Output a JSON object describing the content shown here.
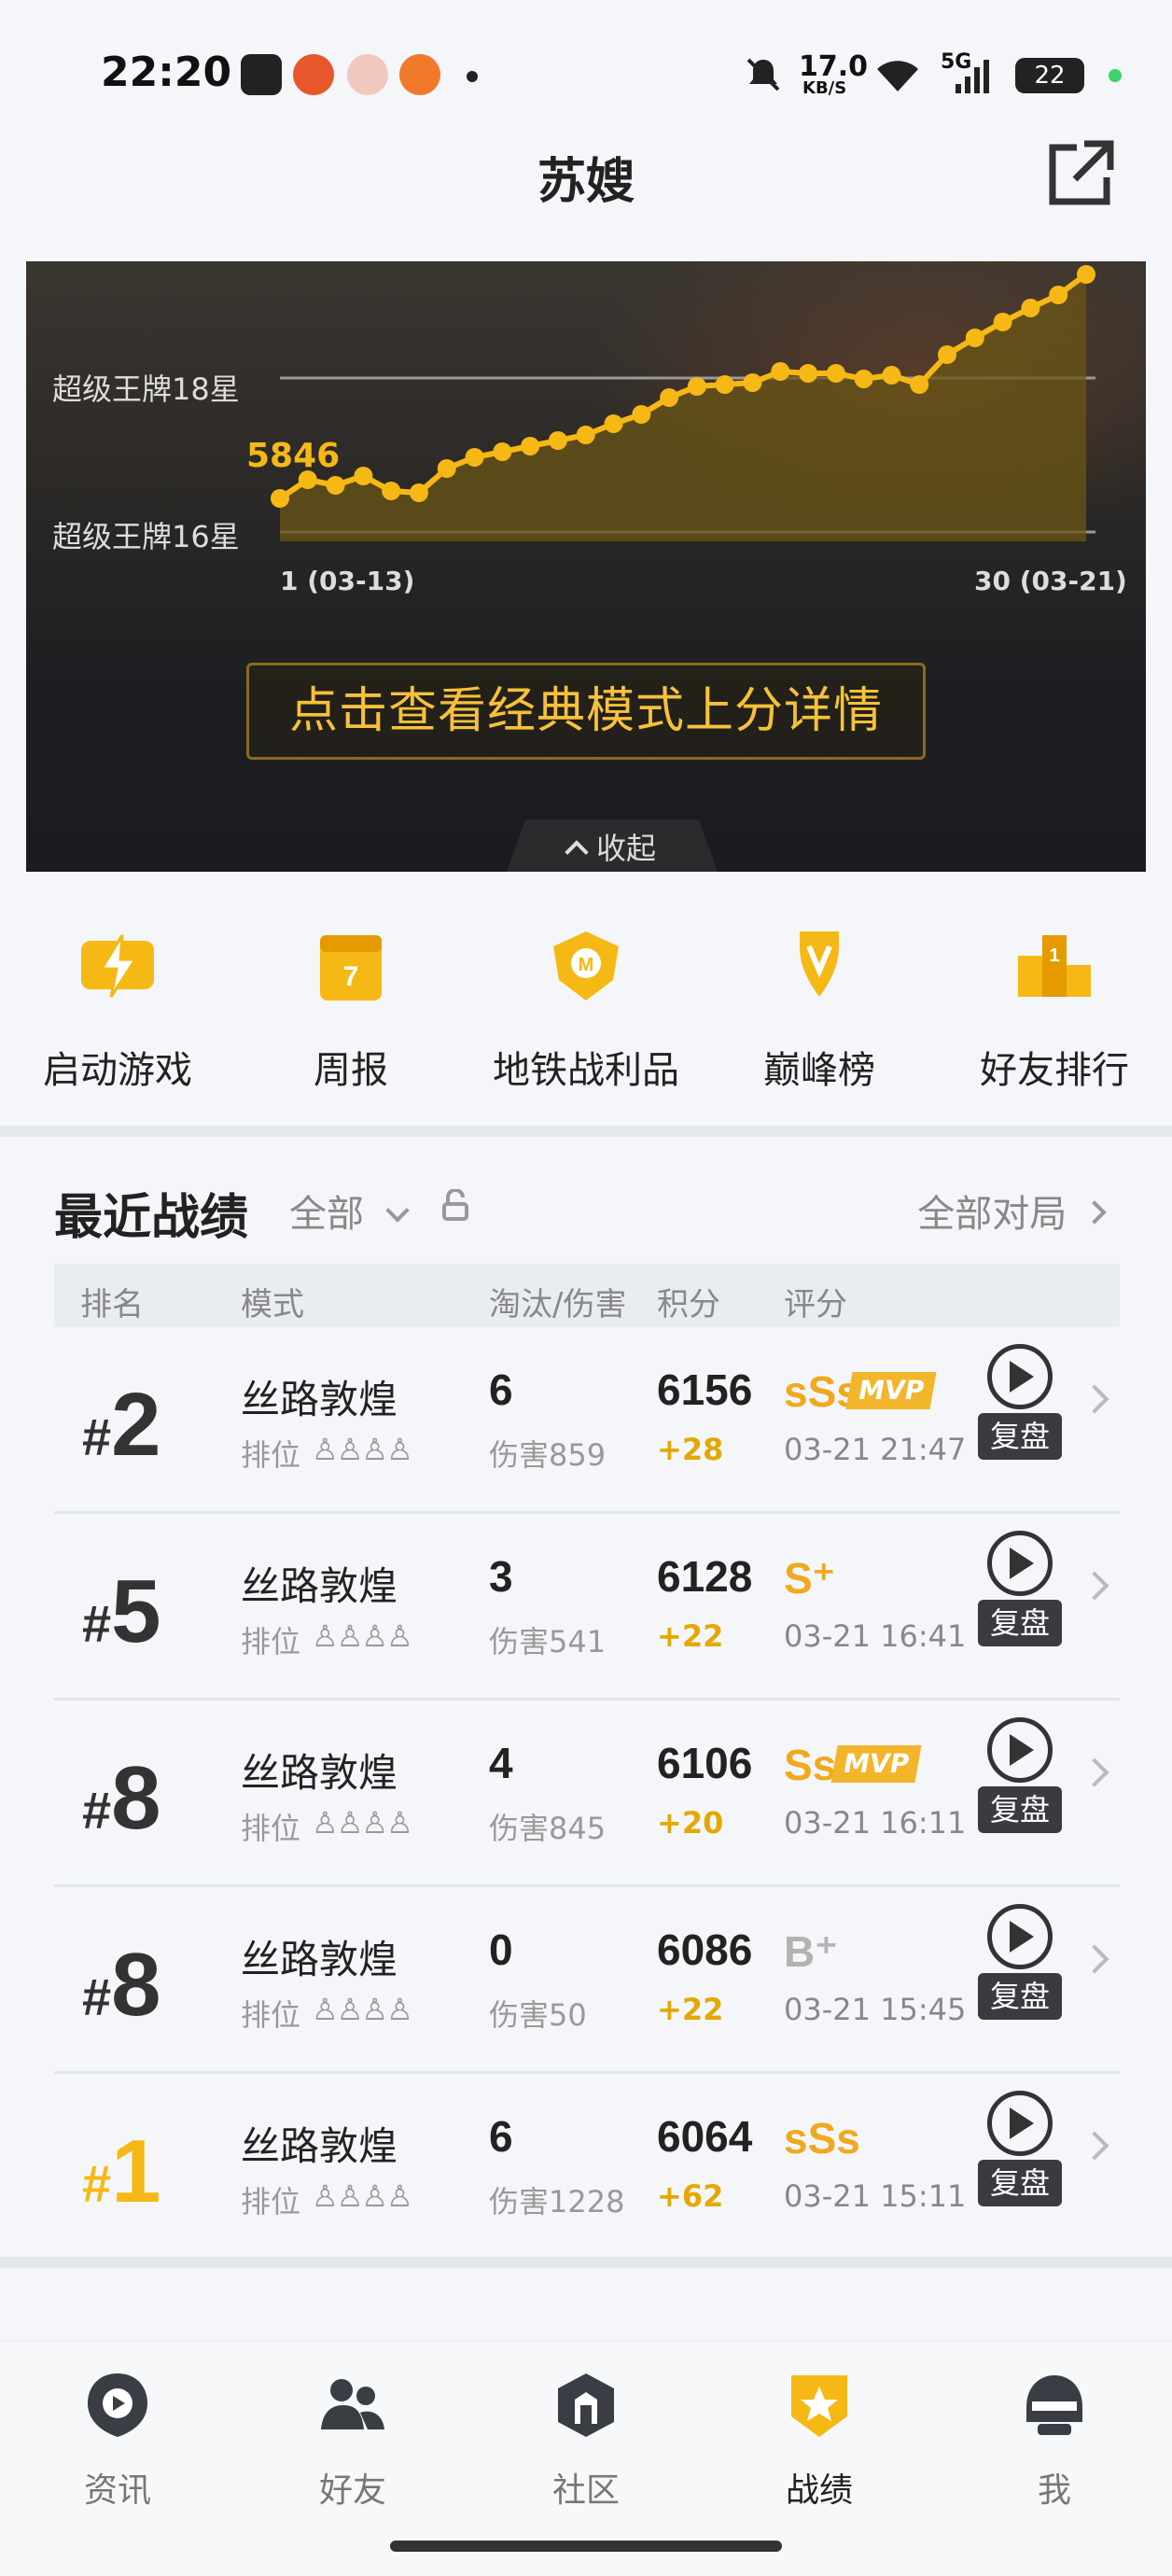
{
  "status_bar": {
    "time": "22:20",
    "network_speed": "17.0",
    "network_unit": "KB/S",
    "signal": "5G",
    "battery": "22"
  },
  "header": {
    "title": "苏嫂",
    "share_icon": "external-link-icon"
  },
  "chart": {
    "tier_upper": "超级王牌18星",
    "tier_lower": "超级王牌16星",
    "start_value": "5846",
    "x_start": "1 (03-13)",
    "x_end": "30 (03-21)",
    "detail_button": "点击查看经典模式上分详情",
    "collapse_label": "收起"
  },
  "chart_data": {
    "type": "line",
    "x": [
      1,
      2,
      3,
      4,
      5,
      6,
      7,
      8,
      9,
      10,
      11,
      12,
      13,
      14,
      15,
      16,
      17,
      18,
      19,
      20,
      21,
      22,
      23,
      24,
      25,
      26,
      27,
      28,
      29,
      30
    ],
    "values": [
      5846,
      5866,
      5860,
      5870,
      5854,
      5852,
      5878,
      5890,
      5896,
      5902,
      5908,
      5914,
      5926,
      5936,
      5954,
      5966,
      5968,
      5970,
      5982,
      5980,
      5980,
      5974,
      5978,
      5968,
      6000,
      6018,
      6035,
      6050,
      6064,
      6086
    ],
    "xlabel": "",
    "ylabel": "",
    "grid": true,
    "colors": {
      "line": "#f6b814",
      "fill": "#6b5616"
    }
  },
  "shortcuts": [
    {
      "label": "启动游戏",
      "icon": "lightning-icon"
    },
    {
      "label": "周报",
      "icon": "calendar-icon"
    },
    {
      "label": "地铁战利品",
      "icon": "metro-badge-icon"
    },
    {
      "label": "巅峰榜",
      "icon": "trophy-icon"
    },
    {
      "label": "好友排行",
      "icon": "podium-icon"
    }
  ],
  "recent": {
    "title": "最近战绩",
    "filter": "全部",
    "all_matches": "全部对局",
    "columns": [
      "排名",
      "模式",
      "淘汰/伤害",
      "积分",
      "评分"
    ],
    "rows": [
      {
        "hash": "#",
        "rank": "2",
        "mode": "丝路敦煌",
        "type": "排位",
        "kills": "6",
        "damage": "伤害859",
        "score": "6156",
        "delta": "+28",
        "grade": "sSs",
        "mvp": "MVP",
        "time": "03-21 21:47",
        "replay": "复盘"
      },
      {
        "hash": "#",
        "rank": "5",
        "mode": "丝路敦煌",
        "type": "排位",
        "kills": "3",
        "damage": "伤害541",
        "score": "6128",
        "delta": "+22",
        "grade": "S⁺",
        "mvp": "",
        "time": "03-21 16:41",
        "replay": "复盘"
      },
      {
        "hash": "#",
        "rank": "8",
        "mode": "丝路敦煌",
        "type": "排位",
        "kills": "4",
        "damage": "伤害845",
        "score": "6106",
        "delta": "+20",
        "grade": "Ss",
        "mvp": "MVP",
        "time": "03-21 16:11",
        "replay": "复盘"
      },
      {
        "hash": "#",
        "rank": "8",
        "mode": "丝路敦煌",
        "type": "排位",
        "kills": "0",
        "damage": "伤害50",
        "score": "6086",
        "delta": "+22",
        "grade": "B⁺",
        "mvp": "",
        "time": "03-21 15:45",
        "replay": "复盘"
      },
      {
        "hash": "#",
        "rank": "1",
        "mode": "丝路敦煌",
        "type": "排位",
        "kills": "6",
        "damage": "伤害1228",
        "score": "6064",
        "delta": "+62",
        "grade": "sSs",
        "mvp": "",
        "time": "03-21 15:11",
        "replay": "复盘"
      }
    ]
  },
  "tabs": [
    {
      "label": "资讯",
      "icon": "news-icon"
    },
    {
      "label": "好友",
      "icon": "friends-icon"
    },
    {
      "label": "社区",
      "icon": "community-icon"
    },
    {
      "label": "战绩",
      "icon": "record-badge-icon",
      "active": true
    },
    {
      "label": "我",
      "icon": "helmet-icon"
    }
  ],
  "colors": {
    "accent": "#f6b814",
    "text": "#222222",
    "muted": "#888888"
  }
}
